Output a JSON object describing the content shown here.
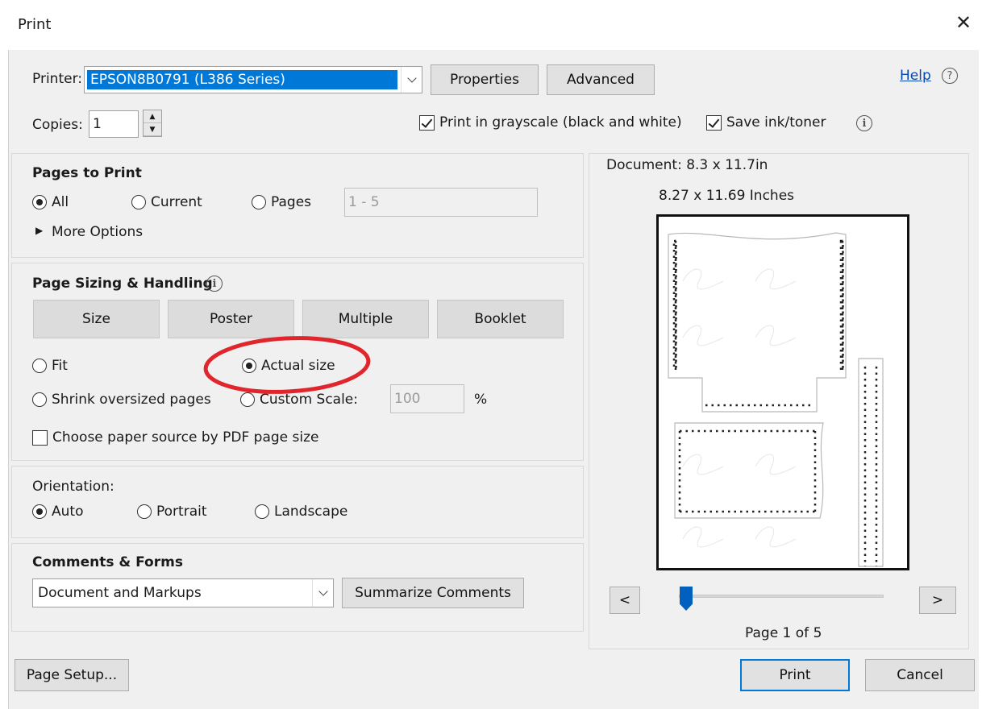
{
  "window": {
    "title": "Print",
    "close_glyph": "✕"
  },
  "printer": {
    "label": "Printer:",
    "value": "EPSON8B0791 (L386 Series)",
    "properties_label": "Properties",
    "advanced_label": "Advanced",
    "help_label": "Help",
    "help_icon": "?"
  },
  "copies": {
    "label": "Copies:",
    "value": "1",
    "up": "▲",
    "down": "▼"
  },
  "options": {
    "grayscale_label": "Print in grayscale (black and white)",
    "grayscale_checked": true,
    "save_ink_label": "Save ink/toner",
    "save_ink_checked": true,
    "info_icon": "i"
  },
  "pages_to_print": {
    "heading": "Pages to Print",
    "all_label": "All",
    "current_label": "Current",
    "pages_label": "Pages",
    "pages_value": "1 - 5",
    "selected": "All",
    "more_options_glyph": "▶",
    "more_options_label": "More Options"
  },
  "page_sizing": {
    "heading": "Page Sizing & Handling",
    "info_icon": "i",
    "buttons": [
      "Size",
      "Poster",
      "Multiple",
      "Booklet"
    ],
    "fit_label": "Fit",
    "actual_label": "Actual size",
    "shrink_label": "Shrink oversized pages",
    "custom_label": "Custom Scale:",
    "custom_value": "100",
    "custom_unit": "%",
    "selected": "Actual size",
    "paper_source_label": "Choose paper source by PDF page size",
    "paper_source_checked": false
  },
  "orientation": {
    "heading": "Orientation:",
    "auto_label": "Auto",
    "portrait_label": "Portrait",
    "landscape_label": "Landscape",
    "selected": "Auto"
  },
  "comments_forms": {
    "heading": "Comments & Forms",
    "value": "Document and Markups",
    "summarize_label": "Summarize Comments"
  },
  "preview": {
    "document_size": "Document: 8.3 x 11.7in",
    "paper_size": "8.27 x 11.69 Inches",
    "prev_label": "<",
    "next_label": ">",
    "page_label": "Page 1 of 5"
  },
  "footer": {
    "page_setup_label": "Page Setup...",
    "print_label": "Print",
    "cancel_label": "Cancel"
  },
  "annotation": {
    "color": "#e0262c"
  },
  "colors": {
    "accent": "#0078d7",
    "dialog_bg": "#f0f0f0"
  }
}
